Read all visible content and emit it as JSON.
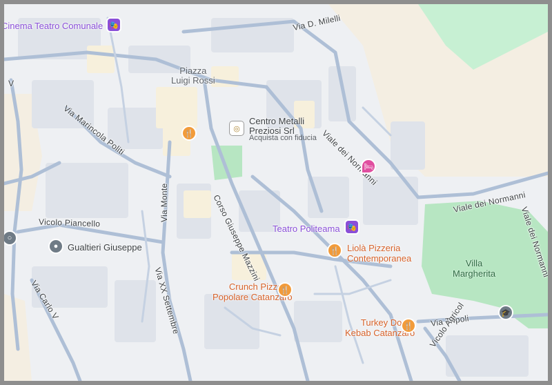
{
  "streets": {
    "via_d_milelli": "Via D. Milelli",
    "viale_dei_normanni_top": "Viale dei Normanni",
    "viale_dei_normanni_mid": "Viale dei Normanni",
    "viale_dei_normanni_right": "Viale dei Normanni",
    "via_marincola_politi": "Via Marincola Politi",
    "via_monte": "Via Monte",
    "corso_giuseppe_mazzini": "Corso Giuseppe Mazzini",
    "vico_piancello": "Vicolo Piancello",
    "via_xx_settembre": "Via XX Settembre",
    "via_carlo_v": "Via Carlo V",
    "via_tripoli": "Via Tripoli",
    "vicolo_agricola": "Vicolo Agricol",
    "via_v_left": "V"
  },
  "places": {
    "cinema_teatro_comunale": "Cinema Teatro Comunale",
    "piazza_luigi_rossi": "Piazza\nLuigi Rossi",
    "centro_metalli_name": "Centro Metalli\nPreziosi Srl",
    "centro_metalli_sub": "Acquista con fiducia",
    "teatro_politeama": "Teatro Politeama",
    "liola_pizzeria": "Liolà Pizzeria\nContemporanea",
    "gualtieri_giuseppe": "Gualtieri Giuseppe",
    "crunch_pizzeria": "Crunch Pizzeria\nPopolare Catanzaro",
    "turkey_doner": "Turkey Doner\nKebab Catanzaro",
    "villa_margherita": "Villa\nMargherita"
  },
  "colors": {
    "map_bg": "#eef0f3",
    "block": "#dfe3ea",
    "road": "#aebfd6",
    "park": "#b7e6c2",
    "beige": "#f4eee2",
    "purple_poi": "#8a4fd8",
    "orange_poi": "#f29b3a",
    "grey_poi": "#6f7b86"
  },
  "icons": {
    "theatre": "theatre-mask-icon",
    "restaurant": "fork-knife-icon",
    "hotel": "bed-icon",
    "shop": "shop-logo-icon",
    "school": "graduation-cap-icon",
    "location": "location-pin-icon"
  }
}
